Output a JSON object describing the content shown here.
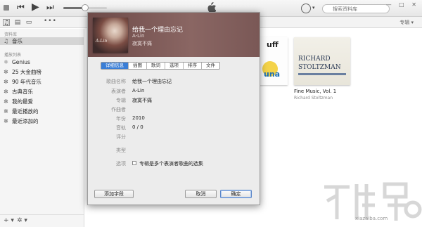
{
  "toolbar": {
    "volume_level": 0.5,
    "search_placeholder": "搜索资料库",
    "window_controls": "— □ ✕"
  },
  "navbar": {
    "more": "•••",
    "right_label": "专辑 ▾"
  },
  "sidebar": {
    "library_heading": "资料库",
    "playlists_heading": "播放列表",
    "library_items": [
      {
        "label": "音乐",
        "icon": "music-note-icon"
      }
    ],
    "playlists": [
      {
        "label": "Genius",
        "icon": "genius-icon"
      },
      {
        "label": "25 大金曲榜",
        "icon": "gear-playlist-icon"
      },
      {
        "label": "90 年代音乐",
        "icon": "gear-playlist-icon"
      },
      {
        "label": "古典音乐",
        "icon": "gear-playlist-icon"
      },
      {
        "label": "我的最爱",
        "icon": "gear-playlist-icon"
      },
      {
        "label": "最近播放的",
        "icon": "gear-playlist-icon"
      },
      {
        "label": "最近添加的",
        "icon": "gear-playlist-icon"
      }
    ],
    "bottom_add": "+ ▾",
    "bottom_settings": "✲ ▾"
  },
  "content": {
    "albums": [
      {
        "title": "Fine Music, Vol. 1",
        "artist": "Richard Stoltzman",
        "art_line1": "RICHARD",
        "art_line2": "STOLTZMAN"
      },
      {
        "art_text": "uff",
        "art_text2": "una"
      }
    ]
  },
  "dialog": {
    "song_title": "给我一个理由忘记",
    "artist": "A-Lin",
    "album": "寂寞不痛",
    "art_caption": "A-Lin",
    "tabs": [
      {
        "label": "详细信息",
        "active": true
      },
      {
        "label": "插图",
        "active": false
      },
      {
        "label": "歌词",
        "active": false
      },
      {
        "label": "选项",
        "active": false
      },
      {
        "label": "排序",
        "active": false
      },
      {
        "label": "文件",
        "active": false
      }
    ],
    "fields": [
      {
        "label": "歌曲名称",
        "value": "给我一个理由忘记"
      },
      {
        "label": "表演者",
        "value": "A-Lin"
      },
      {
        "label": "专辑",
        "value": "寂寞不痛"
      },
      {
        "label": "作曲者",
        "value": ""
      },
      {
        "label": "年份",
        "value": "2010"
      },
      {
        "label": "音轨",
        "value": "0  /  0"
      },
      {
        "label": "评分",
        "value": ""
      },
      {
        "label": "类型",
        "value": ""
      },
      {
        "label": "选项",
        "value": ""
      }
    ],
    "compilation_label": "专辑是多个表演者歌曲的选集",
    "add_field_button": "添加字段",
    "cancel_button": "取消",
    "ok_button": "确定"
  },
  "watermark": {
    "text": "xiazaiba.com"
  },
  "colors": {
    "accent": "#3a7ed6",
    "dialog_header": "#7a5856"
  }
}
